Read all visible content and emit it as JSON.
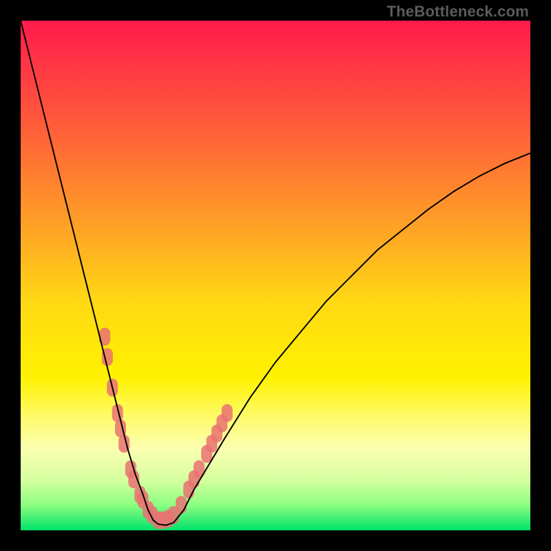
{
  "watermark": "TheBottleneck.com",
  "chart_data": {
    "type": "line",
    "title": "",
    "xlabel": "",
    "ylabel": "",
    "xlim": [
      0,
      100
    ],
    "ylim": [
      0,
      100
    ],
    "grid": false,
    "legend": false,
    "background": {
      "type": "vertical-gradient",
      "stops": [
        {
          "offset": 0.0,
          "color": "#ff1b4c"
        },
        {
          "offset": 0.2,
          "color": "#ff5a3a"
        },
        {
          "offset": 0.4,
          "color": "#ffa026"
        },
        {
          "offset": 0.55,
          "color": "#ffd814"
        },
        {
          "offset": 0.7,
          "color": "#fff200"
        },
        {
          "offset": 0.78,
          "color": "#fffb6e"
        },
        {
          "offset": 0.84,
          "color": "#fbffb0"
        },
        {
          "offset": 0.9,
          "color": "#d6ffa0"
        },
        {
          "offset": 0.95,
          "color": "#8dff80"
        },
        {
          "offset": 1.0,
          "color": "#00e26a"
        }
      ]
    },
    "series": [
      {
        "name": "bottleneck-curve",
        "x": [
          0,
          2,
          4,
          6,
          8,
          10,
          12,
          14,
          16,
          18,
          19.5,
          21,
          22.5,
          24,
          25,
          26,
          27,
          28.5,
          30,
          32,
          34,
          37,
          40,
          45,
          50,
          55,
          60,
          65,
          70,
          75,
          80,
          85,
          90,
          95,
          100
        ],
        "y": [
          100,
          92,
          84,
          76,
          68,
          60,
          52,
          44,
          36,
          28,
          22,
          16,
          11,
          7,
          4,
          2,
          1.2,
          1,
          1.5,
          4,
          8,
          13,
          18,
          26,
          33,
          39,
          45,
          50,
          55,
          59,
          63,
          66.5,
          69.5,
          72,
          74
        ]
      }
    ],
    "minimum_x": 27,
    "beads": {
      "name": "highlighted-points",
      "color": "#e97272",
      "points": [
        {
          "x": 16.5,
          "y": 38
        },
        {
          "x": 17.0,
          "y": 34
        },
        {
          "x": 18.0,
          "y": 28
        },
        {
          "x": 19.0,
          "y": 23
        },
        {
          "x": 19.6,
          "y": 20
        },
        {
          "x": 20.3,
          "y": 17
        },
        {
          "x": 21.6,
          "y": 12
        },
        {
          "x": 22.2,
          "y": 10
        },
        {
          "x": 23.4,
          "y": 7
        },
        {
          "x": 24.0,
          "y": 6
        },
        {
          "x": 25.0,
          "y": 4
        },
        {
          "x": 25.8,
          "y": 3
        },
        {
          "x": 27.0,
          "y": 2
        },
        {
          "x": 28.0,
          "y": 2
        },
        {
          "x": 29.0,
          "y": 2.3
        },
        {
          "x": 30.0,
          "y": 3
        },
        {
          "x": 31.5,
          "y": 5
        },
        {
          "x": 33.0,
          "y": 8
        },
        {
          "x": 34.0,
          "y": 10
        },
        {
          "x": 35.0,
          "y": 12
        },
        {
          "x": 36.5,
          "y": 15
        },
        {
          "x": 37.5,
          "y": 17
        },
        {
          "x": 38.5,
          "y": 19
        },
        {
          "x": 39.5,
          "y": 21
        },
        {
          "x": 40.5,
          "y": 23
        }
      ]
    }
  }
}
